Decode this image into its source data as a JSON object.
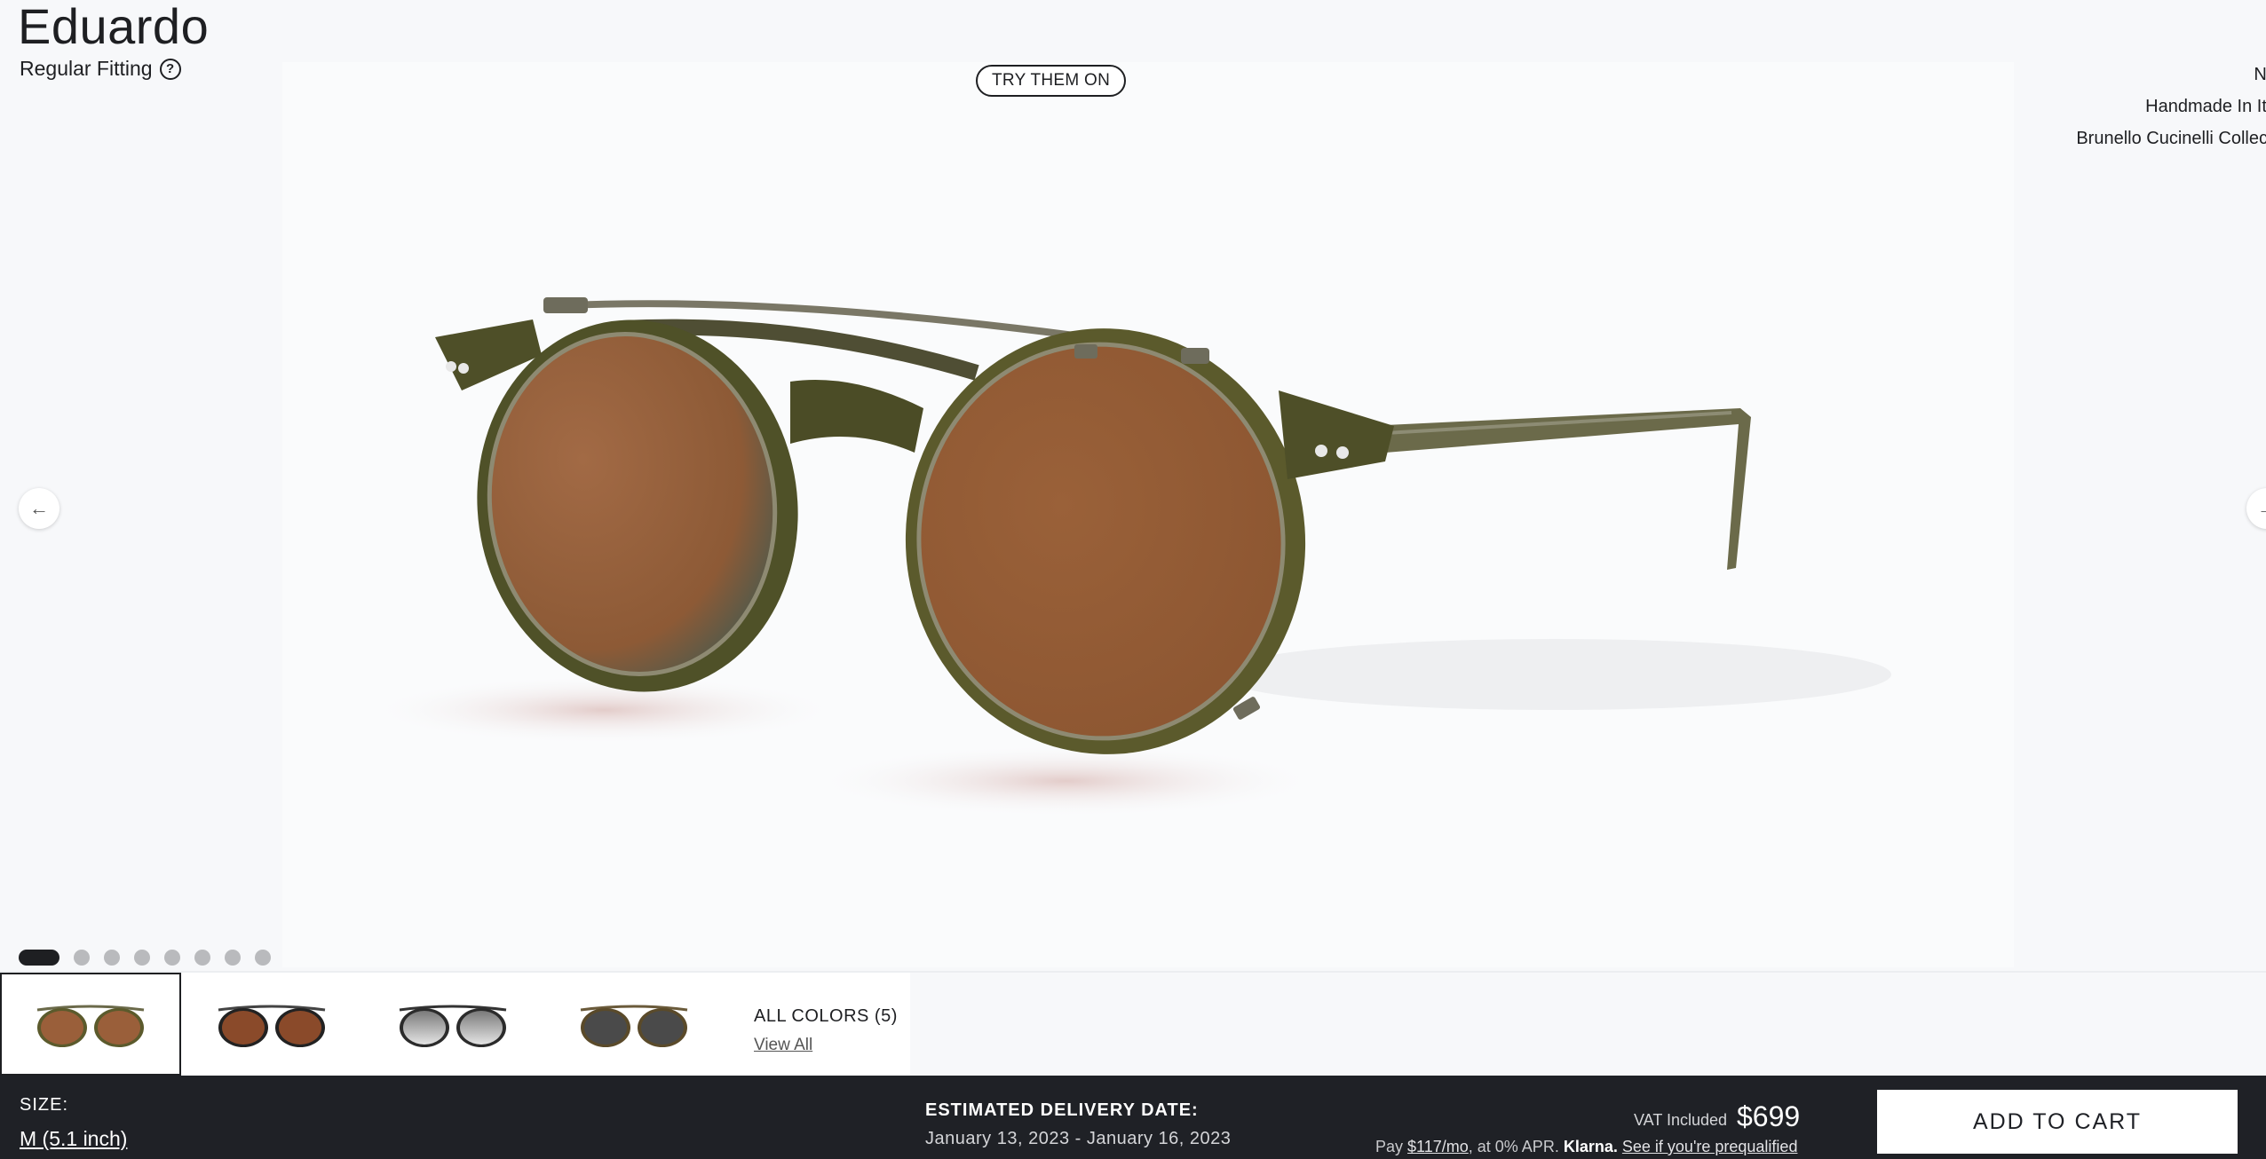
{
  "product": {
    "name": "Eduardo",
    "fitting": "Regular Fitting",
    "help_icon": "question-circle-icon",
    "try_on_label": "TRY THEM ON",
    "features": [
      "Ne",
      "Handmade In Ita",
      "Brunello Cucinelli Collecti"
    ]
  },
  "gallery": {
    "prev_icon": "arrow-left-icon",
    "next_icon": "arrow-right-icon",
    "dot_count": 8,
    "active_dot": 0
  },
  "colors": {
    "all_colors_label": "ALL COLORS (5)",
    "view_all_label": "View All",
    "swatches": [
      "brown-lens-olive-frame",
      "brown-lens-black-frame",
      "grey-gradient-lens-clear-frame",
      "grey-lens-tortoise-frame"
    ]
  },
  "purchase": {
    "size_label": "SIZE:",
    "size_value": "M (5.1 inch)",
    "delivery_label": "ESTIMATED DELIVERY DATE:",
    "delivery_value": "January 13, 2023 - January 16, 2023",
    "vat_label": "VAT Included",
    "price": "$699",
    "klarna_pay": "Pay",
    "klarna_amount": "$117/mo",
    "klarna_apr": ", at 0% APR.",
    "klarna_brand": "Klarna.",
    "klarna_link": "See if you're prequalified",
    "add_to_cart": "ADD TO CART"
  },
  "colors_theme": {
    "bar_background": "#1f2126",
    "lens_brown": "#9a5f3a",
    "frame_olive": "#5b5a2c"
  }
}
